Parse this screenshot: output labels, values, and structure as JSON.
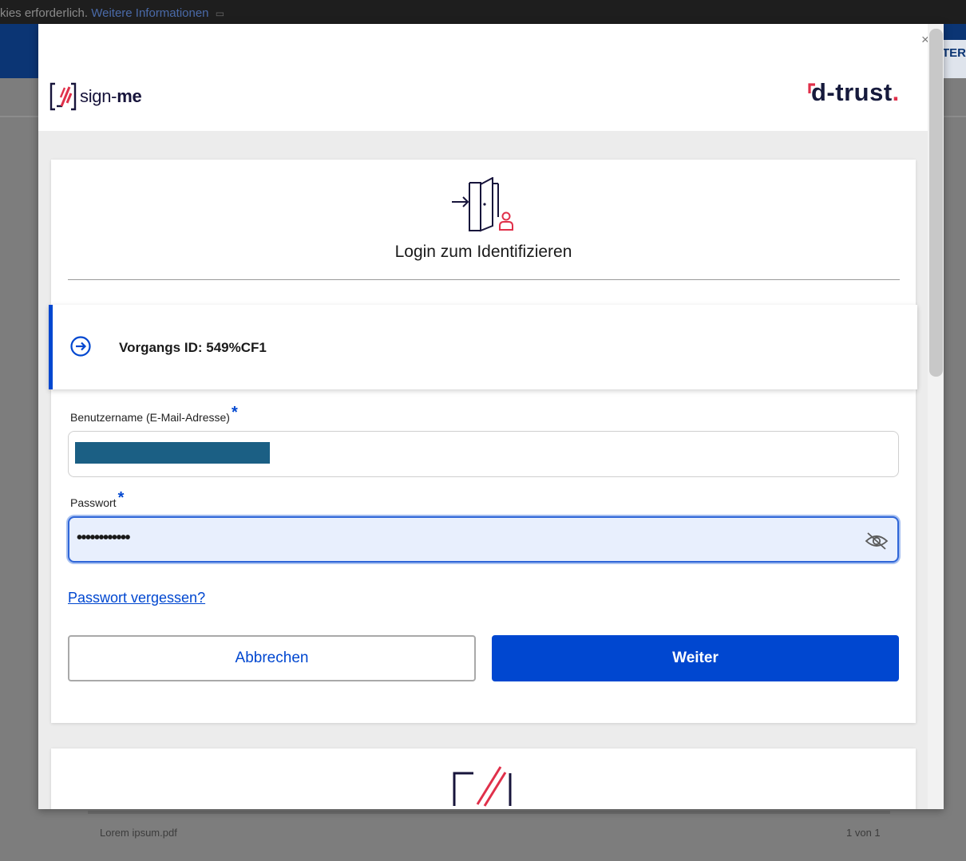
{
  "background": {
    "cookie_text": "kies erforderlich.",
    "cookie_link": "Weitere Informationen",
    "nav_button_fragment": "TER",
    "file_name": "Lorem ipsum.pdf",
    "page_count": "1 von 1"
  },
  "modal": {
    "close_label": "×",
    "brand": {
      "signme_prefix": "sign-",
      "signme_suffix": "me",
      "dtrust_text": "d-trust",
      "dtrust_dot": "."
    },
    "card": {
      "title": "Login zum Identifizieren",
      "process_id": "Vorgangs ID: 549%CF1",
      "username_label": "Benutzername (E-Mail-Adresse)",
      "password_label": "Passwort",
      "required_marker": "*",
      "password_value": "••••••••••••",
      "forgot_link": "Passwort vergessen?",
      "cancel_button": "Abbrechen",
      "next_button": "Weiter"
    }
  },
  "colors": {
    "accent": "#0047d0",
    "brand_navy": "#17143b",
    "brand_red": "#e0304a",
    "nav_blue": "#0b3574"
  },
  "icons": [
    "external-link-icon",
    "close-icon",
    "signme-logo-icon",
    "login-door-icon",
    "arrow-circle-right-icon",
    "eye-slash-icon",
    "signature-frame-icon"
  ]
}
